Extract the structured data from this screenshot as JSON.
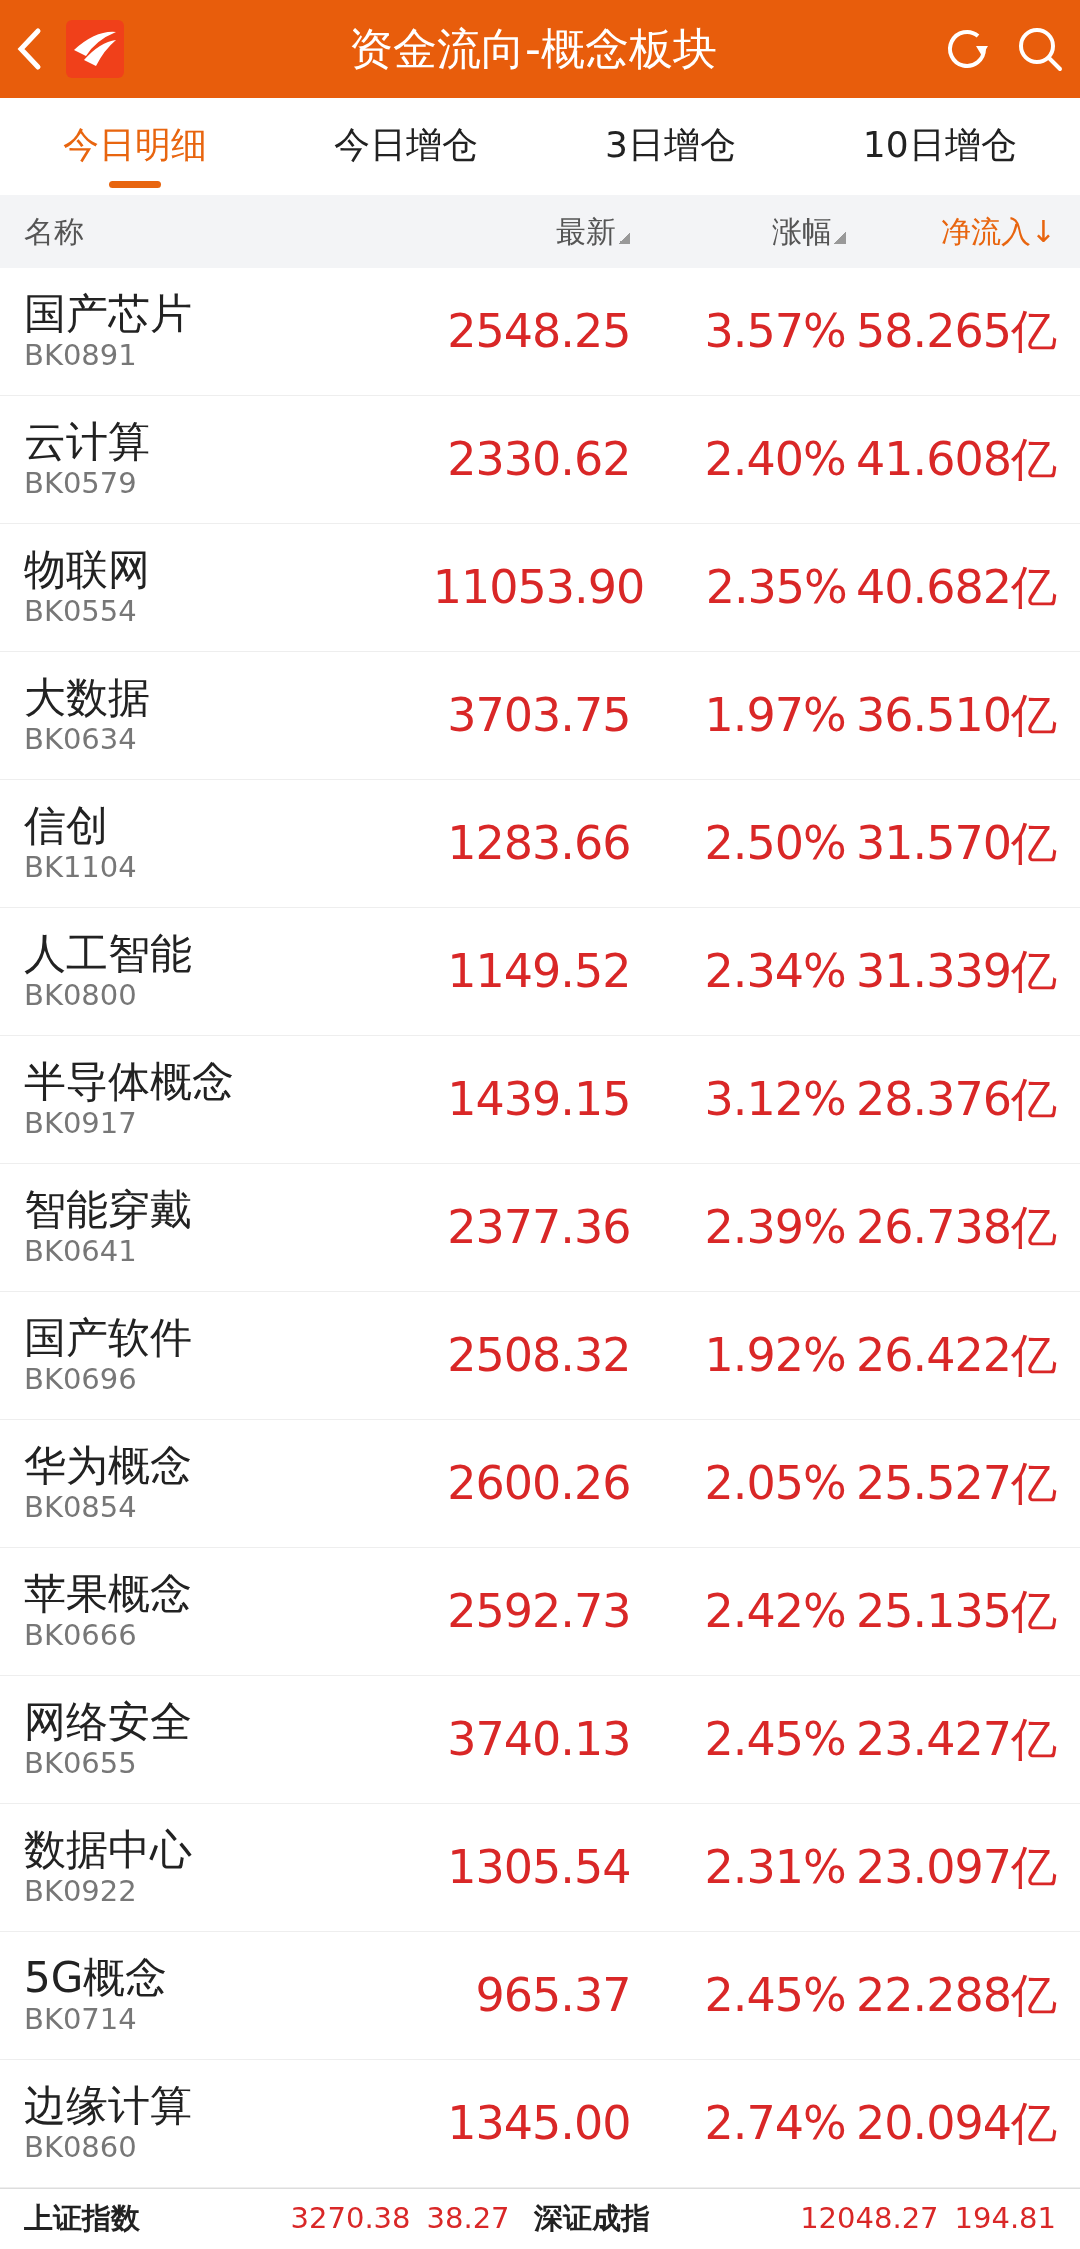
{
  "header": {
    "title": "资金流向-概念板块"
  },
  "tabs": [
    {
      "label": "今日明细",
      "selected": true
    },
    {
      "label": "今日增仓",
      "selected": false
    },
    {
      "label": "3日增仓",
      "selected": false
    },
    {
      "label": "10日增仓",
      "selected": false
    }
  ],
  "table": {
    "columns": [
      {
        "label": "名称",
        "kind": "plain"
      },
      {
        "label": "最新",
        "kind": "sortable"
      },
      {
        "label": "涨幅",
        "kind": "sortable"
      },
      {
        "label": "净流入↓",
        "kind": "sorted"
      }
    ],
    "rows": [
      {
        "name": "国产芯片",
        "code": "BK0891",
        "price": "2548.25",
        "change": "3.57%",
        "net_inflow": "58.265亿"
      },
      {
        "name": "云计算",
        "code": "BK0579",
        "price": "2330.62",
        "change": "2.40%",
        "net_inflow": "41.608亿"
      },
      {
        "name": "物联网",
        "code": "BK0554",
        "price": "11053.90",
        "change": "2.35%",
        "net_inflow": "40.682亿"
      },
      {
        "name": "大数据",
        "code": "BK0634",
        "price": "3703.75",
        "change": "1.97%",
        "net_inflow": "36.510亿"
      },
      {
        "name": "信创",
        "code": "BK1104",
        "price": "1283.66",
        "change": "2.50%",
        "net_inflow": "31.570亿"
      },
      {
        "name": "人工智能",
        "code": "BK0800",
        "price": "1149.52",
        "change": "2.34%",
        "net_inflow": "31.339亿"
      },
      {
        "name": "半导体概念",
        "code": "BK0917",
        "price": "1439.15",
        "change": "3.12%",
        "net_inflow": "28.376亿"
      },
      {
        "name": "智能穿戴",
        "code": "BK0641",
        "price": "2377.36",
        "change": "2.39%",
        "net_inflow": "26.738亿"
      },
      {
        "name": "国产软件",
        "code": "BK0696",
        "price": "2508.32",
        "change": "1.92%",
        "net_inflow": "26.422亿"
      },
      {
        "name": "华为概念",
        "code": "BK0854",
        "price": "2600.26",
        "change": "2.05%",
        "net_inflow": "25.527亿"
      },
      {
        "name": "苹果概念",
        "code": "BK0666",
        "price": "2592.73",
        "change": "2.42%",
        "net_inflow": "25.135亿"
      },
      {
        "name": "网络安全",
        "code": "BK0655",
        "price": "3740.13",
        "change": "2.45%",
        "net_inflow": "23.427亿"
      },
      {
        "name": "数据中心",
        "code": "BK0922",
        "price": "1305.54",
        "change": "2.31%",
        "net_inflow": "23.097亿"
      },
      {
        "name": "5G概念",
        "code": "BK0714",
        "price": "965.37",
        "change": "2.45%",
        "net_inflow": "22.288亿"
      },
      {
        "name": "边缘计算",
        "code": "BK0860",
        "price": "1345.00",
        "change": "2.74%",
        "net_inflow": "20.094亿"
      }
    ]
  },
  "indices": [
    {
      "name": "上证指数",
      "value": "3270.38",
      "change": "38.27"
    },
    {
      "name": "深证成指",
      "value": "12048.27",
      "change": "194.81"
    }
  ]
}
